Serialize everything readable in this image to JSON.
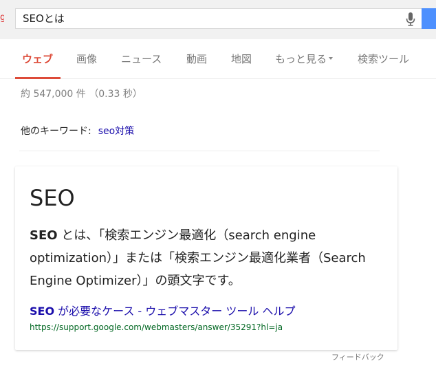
{
  "search": {
    "query": "SEOとは"
  },
  "nav": {
    "tabs": [
      {
        "label": "ウェブ",
        "active": true
      },
      {
        "label": "画像"
      },
      {
        "label": "ニュース"
      },
      {
        "label": "動画"
      },
      {
        "label": "地図"
      },
      {
        "label": "もっと見る"
      },
      {
        "label": "検索ツール"
      }
    ]
  },
  "results": {
    "stats": "約 547,000 件 （0.33 秒）"
  },
  "related": {
    "label": "他のキーワード:",
    "link": "seo対策"
  },
  "card": {
    "title": "SEO",
    "desc_term": "SEO",
    "desc_rest": " とは、「検索エンジン最適化（search engine optimization）」または「検索エンジン最適化業者（Search Engine Optimizer）」の頭文字です。",
    "link_term": "SEO",
    "link_rest": " が必要なケース - ウェブマスター ツール ヘルプ",
    "url": "https://support.google.com/webmasters/answer/35291?hl=ja"
  },
  "footer": {
    "feedback": "フィードバック"
  },
  "colors": {
    "accent": "#dd4b39",
    "link": "#1a0dab",
    "url": "#006621",
    "search_button": "#4d90fe"
  }
}
